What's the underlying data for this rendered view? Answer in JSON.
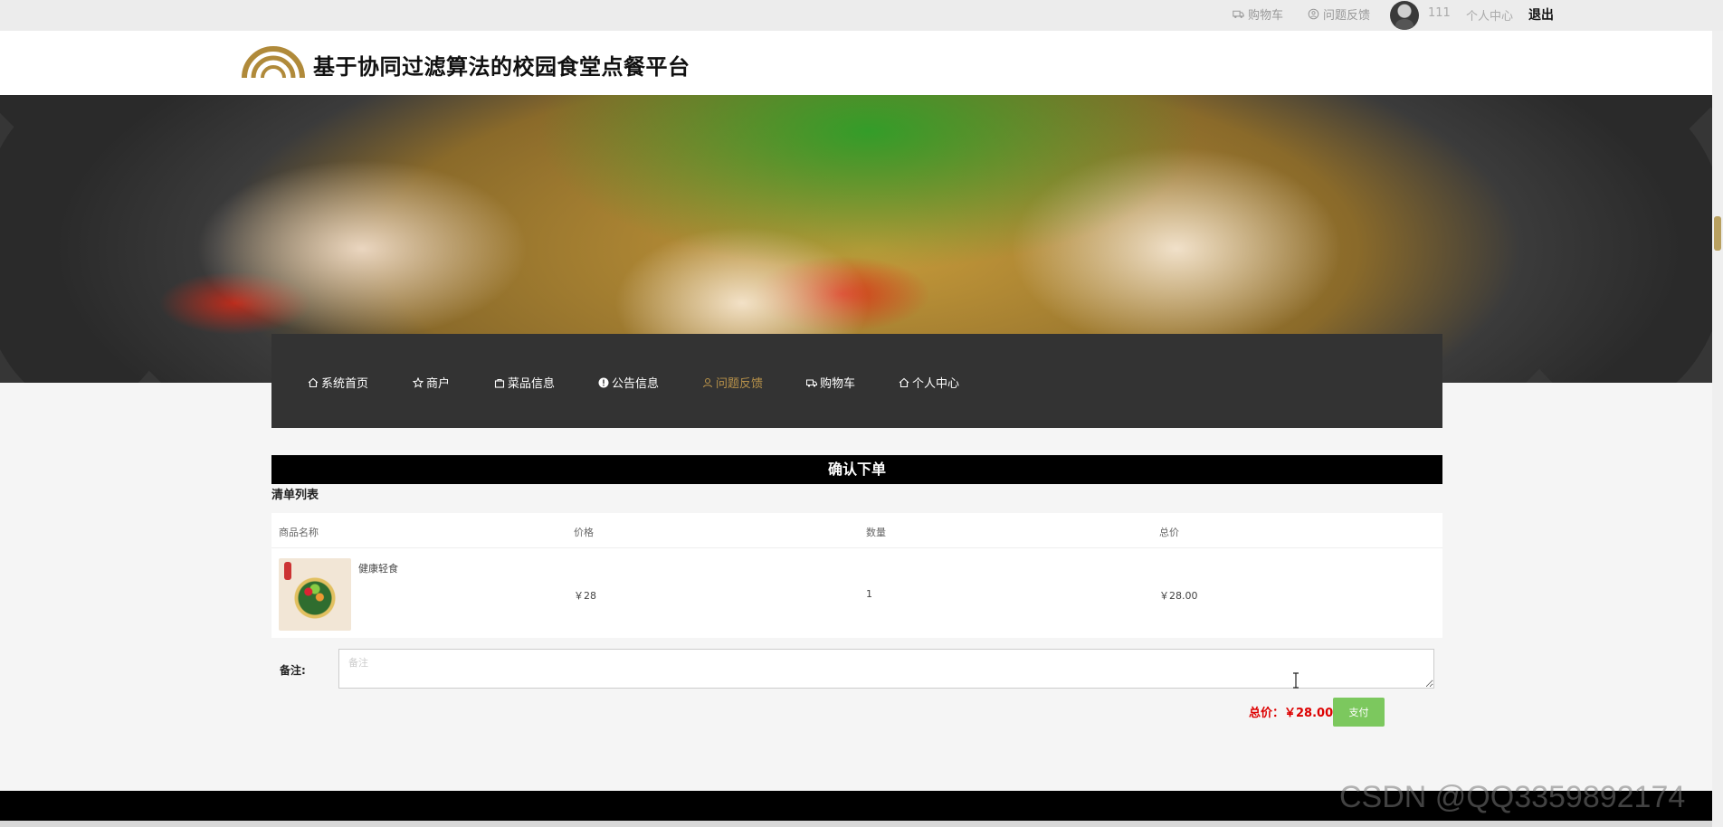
{
  "topbar": {
    "cart_label": "购物车",
    "feedback_label": "问题反馈",
    "username": "111",
    "center_label": "个人中心",
    "logout_label": "退出"
  },
  "header": {
    "site_title": "基于协同过滤算法的校园食堂点餐平台"
  },
  "nav": {
    "items": [
      {
        "label": "系统首页",
        "icon": "home-icon"
      },
      {
        "label": "商户",
        "icon": "star-icon"
      },
      {
        "label": "菜品信息",
        "icon": "bag-icon"
      },
      {
        "label": "公告信息",
        "icon": "info-icon"
      },
      {
        "label": "问题反馈",
        "icon": "user-icon",
        "active": true
      },
      {
        "label": "购物车",
        "icon": "truck-icon"
      },
      {
        "label": "个人中心",
        "icon": "home-icon"
      }
    ]
  },
  "order": {
    "confirm_title": "确认下单",
    "list_title": "清单列表",
    "columns": [
      "商品名称",
      "价格",
      "数量",
      "总价"
    ],
    "rows": [
      {
        "name": "健康轻食",
        "price": "￥28",
        "qty": "1",
        "total": "￥28.00"
      }
    ],
    "note_label": "备注:",
    "note_placeholder": "备注",
    "total_label": "总价：￥28.00",
    "pay_label": "支付"
  },
  "watermark": "CSDN @QQ3359892174",
  "colors": {
    "nav_bg": "#333333",
    "nav_active": "#b8924a",
    "confirm_bar": "#000000",
    "total_text": "#dd0000",
    "pay_button": "#7cc85e"
  }
}
